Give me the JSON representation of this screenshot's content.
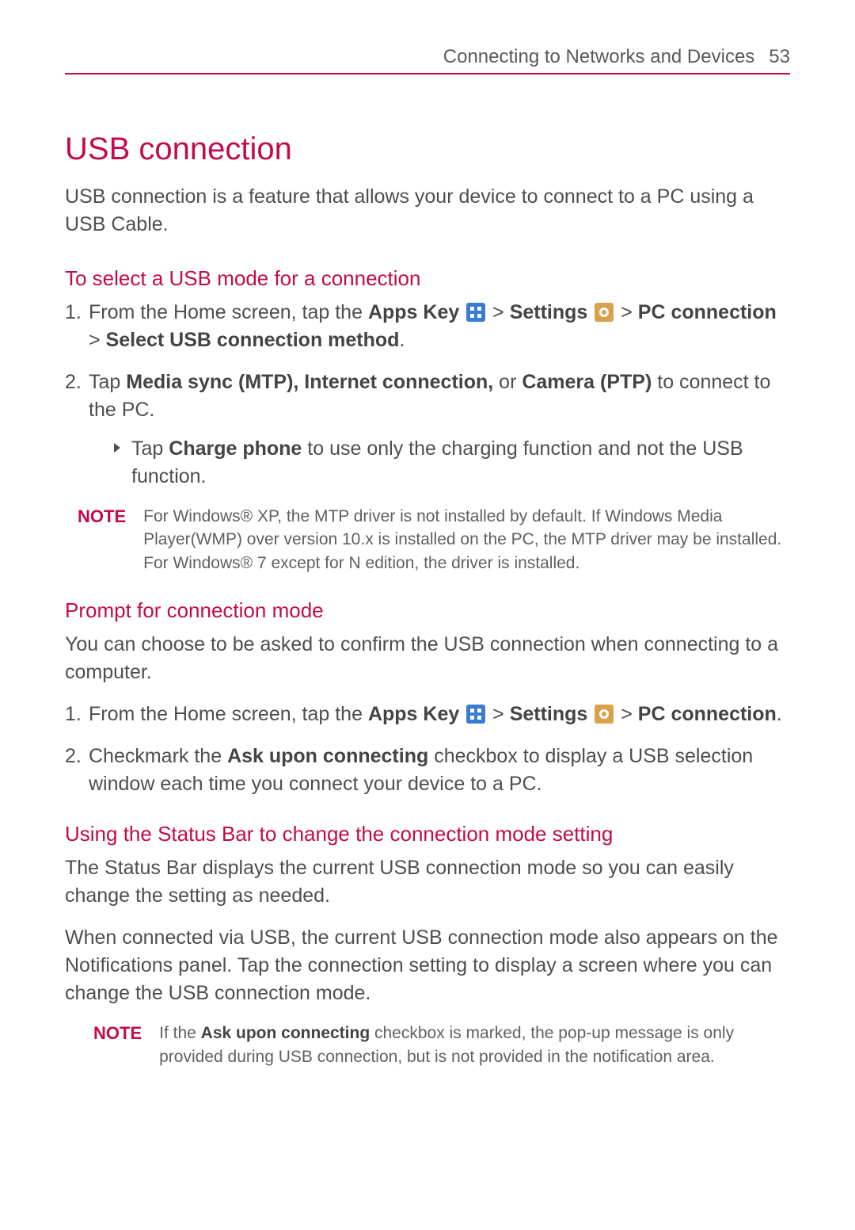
{
  "header": {
    "section": "Connecting to Networks and Devices",
    "page_number": "53"
  },
  "title": "USB connection",
  "intro": "USB connection is a feature that allows your device to connect to a PC using a USB Cable.",
  "section1": {
    "heading": "To select a USB mode for a connection",
    "step1_prefix": "From the Home screen, tap the ",
    "apps_key_label": "Apps Key",
    "gt1": " > ",
    "settings_label": "Settings",
    "gt2": " > ",
    "pc_conn_label": "PC connection",
    "gt3": " > ",
    "select_usb_label": "Select USB connection method",
    "period": ".",
    "step2_tap": "Tap ",
    "step2_bold": "Media sync (MTP), Internet connection,",
    "step2_or": " or ",
    "step2_camera": "Camera (PTP)",
    "step2_tail": " to connect to the PC.",
    "sub_tap": "Tap ",
    "sub_bold": "Charge phone",
    "sub_tail": " to use only the charging function and not the USB function.",
    "note_label": "NOTE",
    "note_body": "For Windows® XP, the MTP driver is not installed by default. If Windows Media Player(WMP) over version 10.x is installed on the PC, the MTP driver may be installed. For Windows® 7 except for N edition, the driver is installed."
  },
  "section2": {
    "heading": "Prompt for connection mode",
    "intro": "You can choose to be asked to confirm the USB connection when connecting to a computer.",
    "step1_prefix": "From the Home screen, tap the ",
    "apps_key_label": "Apps Key",
    "gt1": " > ",
    "settings_label": "Settings",
    "gt2": " > ",
    "pc_conn_label": "PC connection",
    "period": ".",
    "step2_prefix": "Checkmark the ",
    "step2_bold": "Ask upon connecting",
    "step2_tail": " checkbox to display a USB selection window each time you connect your device to a PC."
  },
  "section3": {
    "heading": "Using the Status Bar to change the connection mode setting",
    "p1": "The Status Bar displays the current USB connection mode so you can easily change the setting as needed.",
    "p2": "When connected via USB, the current USB connection mode also appears on the Notifications panel. Tap the connection setting to display a screen where you can change the USB connection mode.",
    "note_label": "NOTE",
    "note_prefix": "If the ",
    "note_bold": "Ask upon connecting",
    "note_tail": " checkbox is marked, the pop-up message is only provided during USB connection, but is not provided in the notification area."
  }
}
